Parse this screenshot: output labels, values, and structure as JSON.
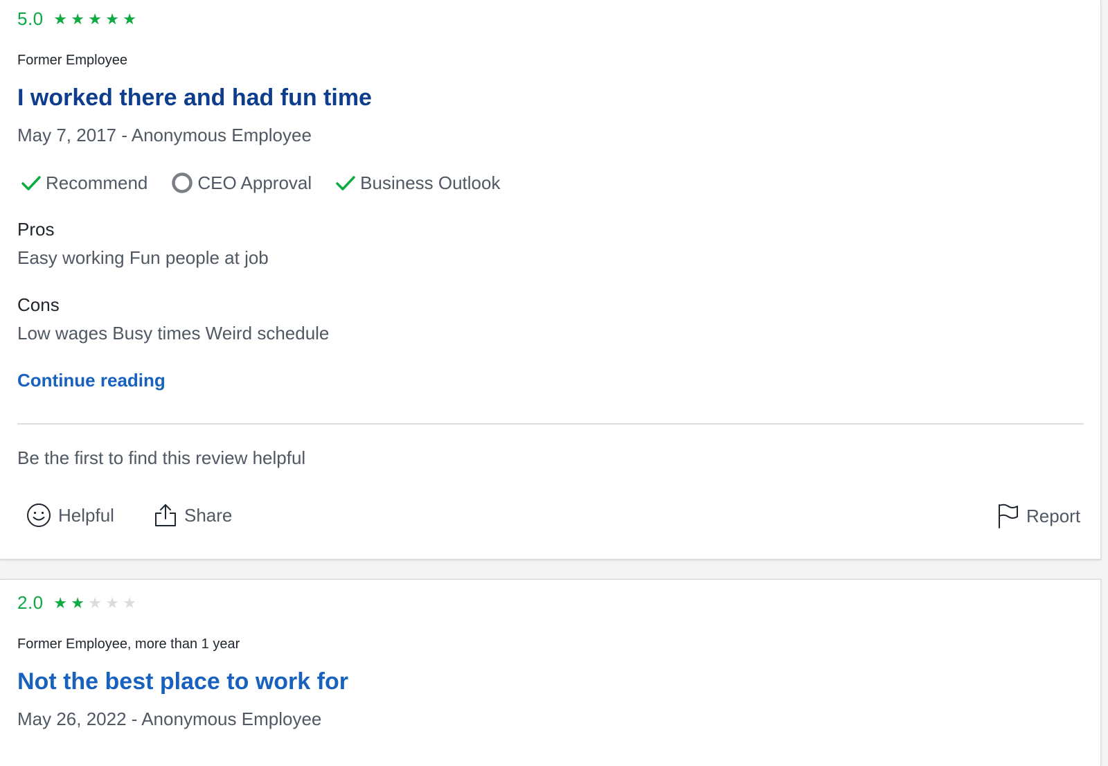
{
  "reviews": [
    {
      "rating": "5.0",
      "stars_filled": 5,
      "stars_total": 5,
      "employee_status": "Former Employee",
      "title": "I worked there and had fun time",
      "date_author": "May 7, 2017 - Anonymous Employee",
      "indicators": [
        {
          "label": "Recommend",
          "icon": "check-icon",
          "state": "positive"
        },
        {
          "label": "CEO Approval",
          "icon": "circle-icon",
          "state": "neutral"
        },
        {
          "label": "Business Outlook",
          "icon": "check-icon",
          "state": "positive"
        }
      ],
      "pros_label": "Pros",
      "pros_text": "Easy working Fun people at job",
      "cons_label": "Cons",
      "cons_text": "Low wages Busy times Weird schedule",
      "continue_label": "Continue reading",
      "helpful_prompt": "Be the first to find this review helpful",
      "actions": {
        "helpful": "Helpful",
        "share": "Share",
        "report": "Report"
      }
    },
    {
      "rating": "2.0",
      "stars_filled": 2,
      "stars_total": 5,
      "employee_status": "Former Employee, more than 1 year",
      "title": "Not the best place to work for",
      "date_author": "May 26, 2022 - Anonymous Employee"
    }
  ],
  "colors": {
    "rating_green": "#0caa41",
    "star_empty": "#dcdcdc",
    "title_dark_blue": "#0d3d8c",
    "link_blue": "#1861bf",
    "neutral_gray": "#505863"
  }
}
